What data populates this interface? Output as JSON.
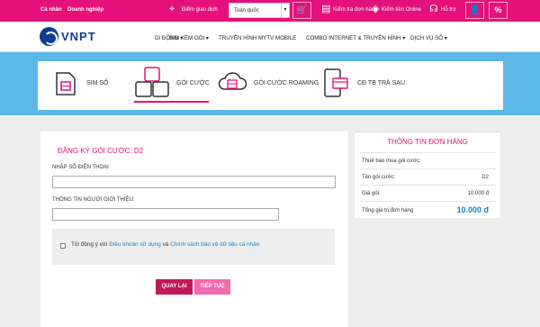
{
  "topbar": {
    "personal": "Cá nhân",
    "business": "Doanh nghiệp",
    "store_locator": "Điểm giao dịch",
    "region_value": "Toàn quốc",
    "check_order": "Kiểm tra đơn hàng",
    "check_online": "Kiểm tiền Online",
    "support": "Hỗ trợ"
  },
  "nav": {
    "logo": "VNPT",
    "items": [
      "DI ĐỘNG",
      "SIM KÈM GÓI",
      "TRUYỀN HÌNH MYTV MOBILE",
      "COMBO INTERNET & TRUYỀN HÌNH",
      "DỊCH VỤ SỐ"
    ]
  },
  "tabs": [
    {
      "label": "SIM SỐ"
    },
    {
      "label": "GÓI CƯỚC"
    },
    {
      "label": "GÓI CƯỚC ROAMING"
    },
    {
      "label": "CĐ TB TRẢ SAU"
    }
  ],
  "form": {
    "title": "ĐĂNG KÝ GÓI CƯỚC: D2",
    "phone_label": "NHẬP SỐ ĐIỆN THOẠI",
    "phone_value": "",
    "referrer_label": "THÔNG TIN NGƯỜI GIỚI THIỆU:",
    "referrer_value": "",
    "agree_prefix": "Tôi đồng ý với",
    "terms_link": "Điều khoản sử dụng",
    "agree_and": "và",
    "privacy_link": "Chính sách bảo vệ dữ liệu cá nhân",
    "back_button": "QUAY LẠI",
    "next_button": "TIẾP TỤC"
  },
  "order": {
    "title": "THÔNG TIN ĐƠN HÀNG",
    "rows": [
      {
        "label": "Thuê bao mua gói cước:",
        "value": ""
      },
      {
        "label": "Tên gói cước:",
        "value": "D2"
      },
      {
        "label": "Giá gói:",
        "value": "10.000 đ"
      },
      {
        "label": "Tổng giá trị đơn hàng",
        "value": "10.000 đ"
      }
    ]
  },
  "colors": {
    "brand": "#e4117a",
    "banner": "#5cb8e9",
    "link": "#1b7fc4",
    "back_button": "#c2185b",
    "next_button": "#f06bb0"
  }
}
